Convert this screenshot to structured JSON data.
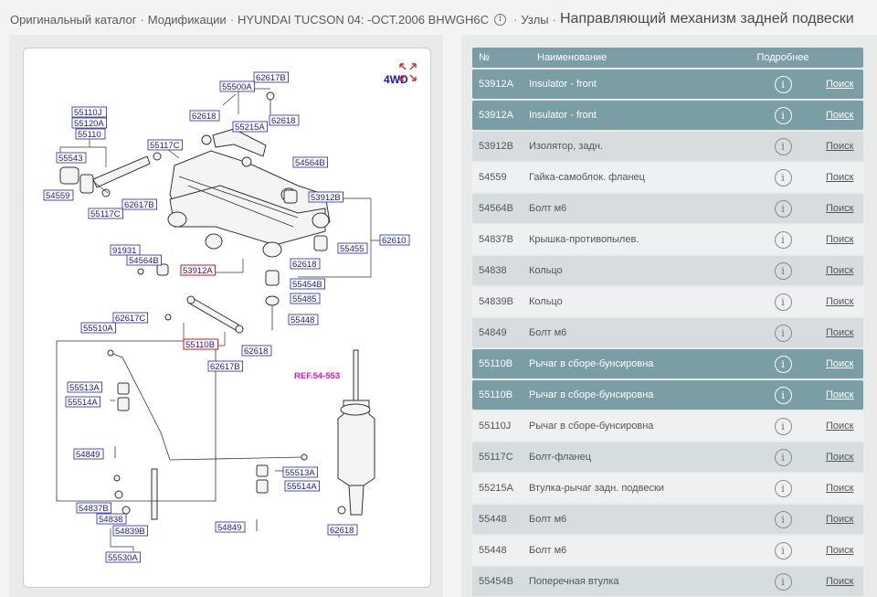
{
  "breadcrumb": {
    "item1": "Оригинальный каталог",
    "item2": "Модификации",
    "item3": "HYUNDAI TUCSON 04: -OCT.2006 BHWGH6C",
    "item4": "Узлы",
    "current": "Направляющий механизм задней подвески",
    "separator": "·",
    "info_glyph": "i"
  },
  "diagram": {
    "drive_label": "4WD",
    "ref_label": "REF.54-553",
    "labels": [
      "62617B",
      "55500A",
      "62618",
      "55215A",
      "62618",
      "55110J",
      "55120A",
      "55110",
      "55117C",
      "55543",
      "54559",
      "55117C",
      "62617B",
      "54564B",
      "53912B",
      "62610",
      "91931",
      "54564B",
      "53912A",
      "62618",
      "55455",
      "55454B",
      "55485",
      "62617C",
      "55448",
      "55510A",
      "55110B",
      "62618",
      "62617B",
      "55513A",
      "55514A",
      "54849",
      "55513A",
      "55514A",
      "54837B",
      "54838",
      "54839B",
      "55530A",
      "54849",
      "62618"
    ],
    "highlighted": [
      "53912A",
      "55110B"
    ]
  },
  "table": {
    "headers": {
      "no": "№",
      "name": "Наименование",
      "more": "Подробнее"
    },
    "info_glyph": "i",
    "rows": [
      {
        "no": "53912A",
        "name": "Insulator - front",
        "link": "Поиск",
        "hl": true
      },
      {
        "no": "53912A",
        "name": "Insulator - front",
        "link": "Поиск",
        "hl": true
      },
      {
        "no": "53912B",
        "name": "Изолятор, задн.",
        "link": "Поиск",
        "hl": false
      },
      {
        "no": "54559",
        "name": "Гайка-самоблок. фланец",
        "link": "Поиск",
        "hl": false
      },
      {
        "no": "54564B",
        "name": "Болт м6",
        "link": "Поиск",
        "hl": false
      },
      {
        "no": "54837B",
        "name": "Крышка-противопылев.",
        "link": "Поиск",
        "hl": false
      },
      {
        "no": "54838",
        "name": "Кольцо",
        "link": "Поиск",
        "hl": false
      },
      {
        "no": "54839B",
        "name": "Кольцо",
        "link": "Поиск",
        "hl": false
      },
      {
        "no": "54849",
        "name": "Болт м6",
        "link": "Поиск",
        "hl": false
      },
      {
        "no": "55110B",
        "name": "Рычаг в сборе-бунсировна",
        "link": "Поиск",
        "hl": true
      },
      {
        "no": "55110B",
        "name": "Рычаг в сборе-бунсировна",
        "link": "Поиск",
        "hl": true
      },
      {
        "no": "55110J",
        "name": "Рычаг в сборе-бунсировна",
        "link": "Поиск",
        "hl": false
      },
      {
        "no": "55117C",
        "name": "Болт-фланец",
        "link": "Поиск",
        "hl": false
      },
      {
        "no": "55215A",
        "name": "Втулка-рычаг задн. подвески",
        "link": "Поиск",
        "hl": false
      },
      {
        "no": "55448",
        "name": "Болт м6",
        "link": "Поиск",
        "hl": false
      },
      {
        "no": "55448",
        "name": "Болт м6",
        "link": "Поиск",
        "hl": false
      },
      {
        "no": "55454B",
        "name": "Поперечная втулка",
        "link": "Поиск",
        "hl": false
      }
    ]
  }
}
